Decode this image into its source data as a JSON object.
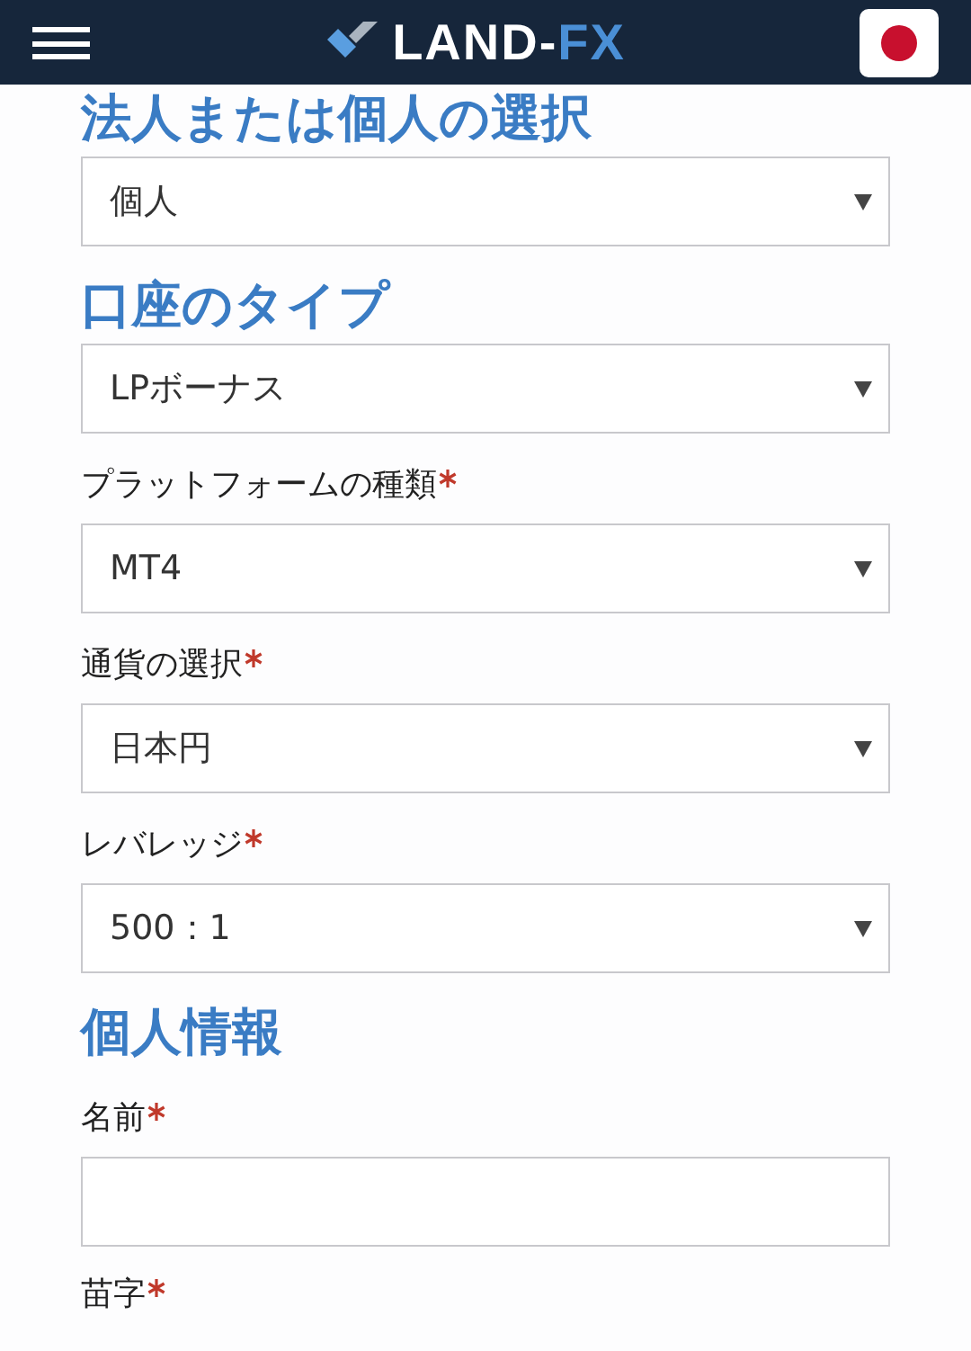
{
  "header": {
    "logo": [
      {
        "text": "LAND-",
        "accent": false
      },
      {
        "text": "FX",
        "accent": true
      }
    ]
  },
  "form": [
    {
      "kind": "heading",
      "text": "法人または個人の選択"
    },
    {
      "kind": "select",
      "value": "個人"
    },
    {
      "kind": "heading",
      "text": "口座のタイプ"
    },
    {
      "kind": "select",
      "value": "LPボーナス"
    },
    {
      "kind": "label",
      "text": "プラットフォームの種類",
      "required": true
    },
    {
      "kind": "select",
      "value": "MT4"
    },
    {
      "kind": "label",
      "text": "通貨の選択",
      "required": true
    },
    {
      "kind": "select",
      "value": "日本円"
    },
    {
      "kind": "label",
      "text": "レバレッジ",
      "required": true
    },
    {
      "kind": "select",
      "value": "500：1"
    },
    {
      "kind": "heading",
      "text": "個人情報"
    },
    {
      "kind": "label",
      "text": "名前",
      "required": true
    },
    {
      "kind": "input"
    },
    {
      "kind": "label",
      "text": "苗字",
      "required": true
    }
  ]
}
